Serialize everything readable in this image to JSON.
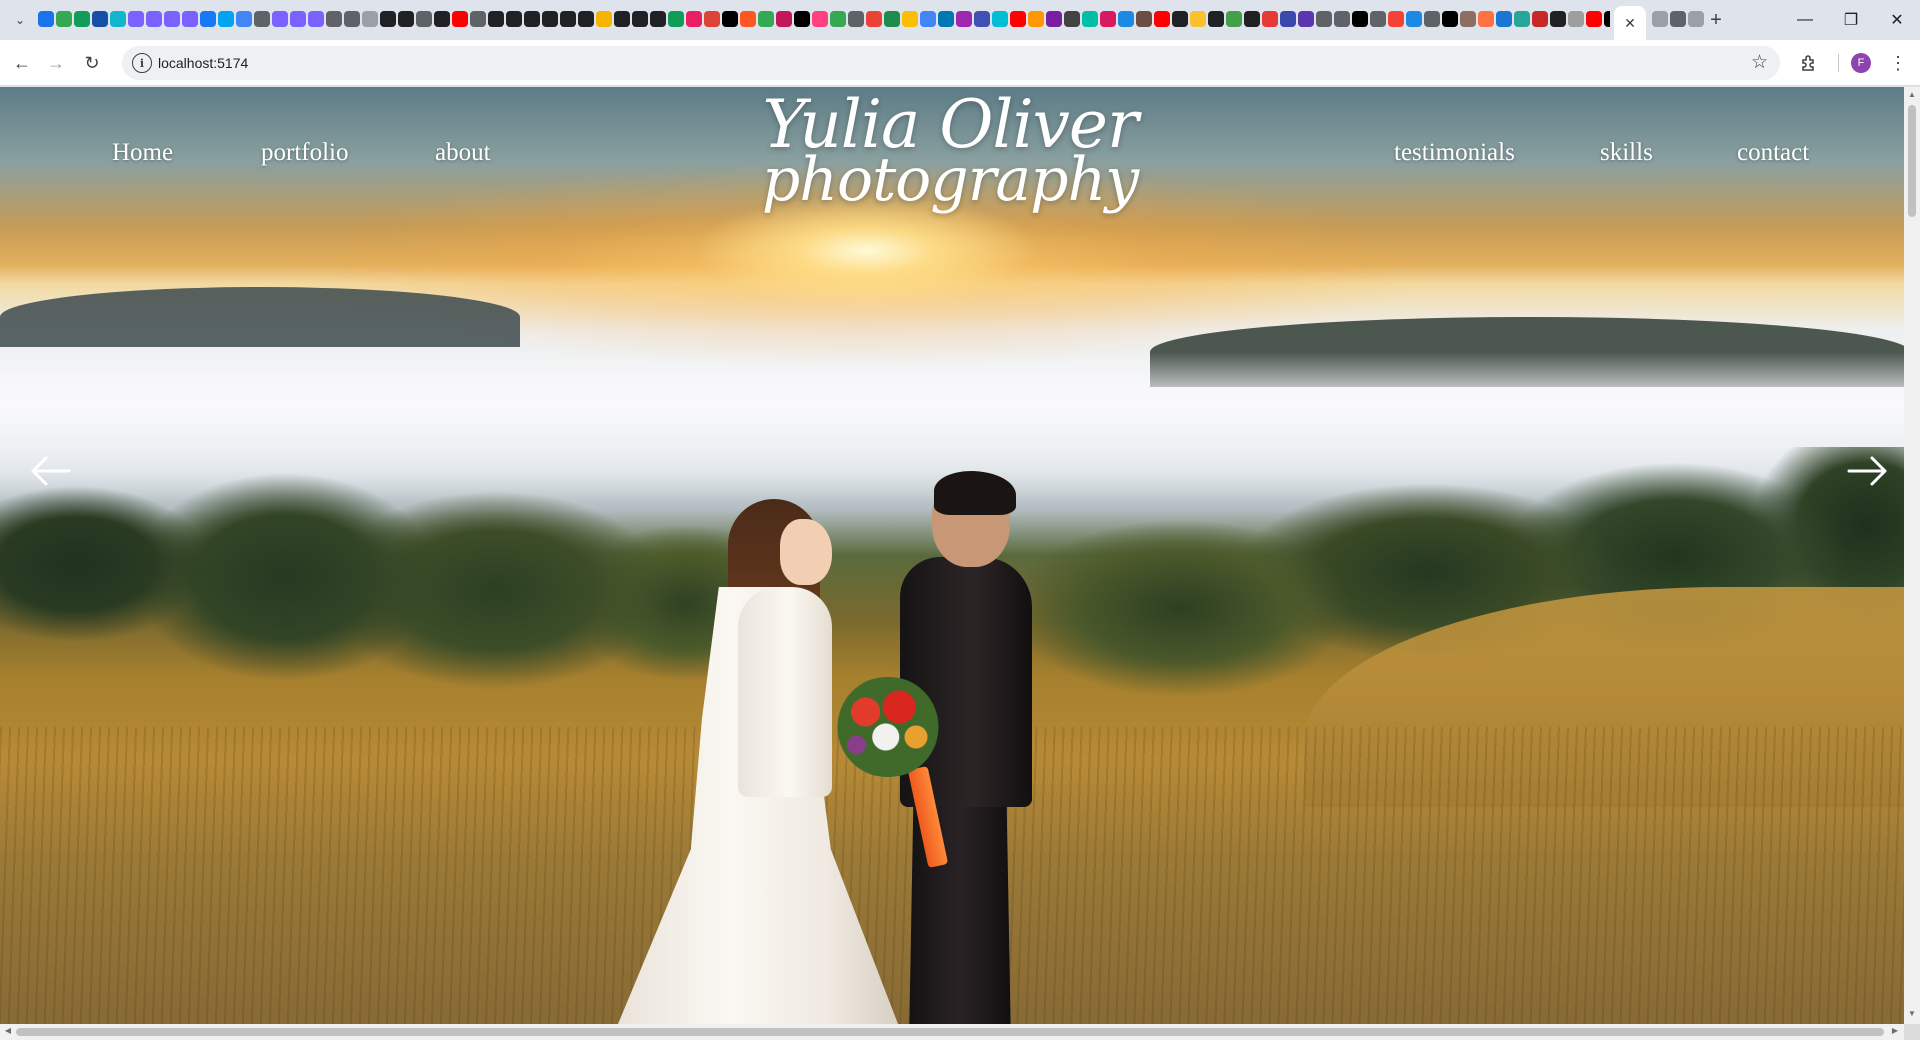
{
  "browser": {
    "tab_menu_icon": "chevron-down-icon",
    "active_tab_close": "✕",
    "new_tab": "+",
    "window_controls": {
      "minimize": "—",
      "restore": "❐",
      "close": "✕"
    },
    "favicon_colors": [
      "#1a73e8",
      "#34a853",
      "#0f9d58",
      "#174ea6",
      "#12b5cb",
      "#7b61ff",
      "#7b61ff",
      "#7b61ff",
      "#7b61ff",
      "#1877f2",
      "#00a4ef",
      "#4285f4",
      "#5f6368",
      "#7b61ff",
      "#7b61ff",
      "#7b61ff",
      "#5f6368",
      "#5f6368",
      "#9aa0a6",
      "#202124",
      "#202124",
      "#5f6368",
      "#202124",
      "#ff0000",
      "#5f6368",
      "#202124",
      "#202124",
      "#202124",
      "#202124",
      "#202124",
      "#202124",
      "#f4b400",
      "#202124",
      "#202124",
      "#202124",
      "#0f9d58",
      "#e91e63",
      "#db4437",
      "#000000",
      "#ff5722",
      "#34a853",
      "#c2185b",
      "#000000",
      "#ff4081",
      "#34a853",
      "#5f6368",
      "#ea4335",
      "#1f8b4c",
      "#fbbc04",
      "#4285f4",
      "#0077b5",
      "#9c27b0",
      "#3f51b5",
      "#00bcd4",
      "#ff0000",
      "#ff9800",
      "#7b1fa2",
      "#424242",
      "#00bfa5",
      "#d81b60",
      "#1e88e5",
      "#6d4c41",
      "#ff0000",
      "#202124",
      "#fbc02d",
      "#202124",
      "#43a047",
      "#202124",
      "#e53935",
      "#3949ab",
      "#5e35b1",
      "#5f6368",
      "#5f6368",
      "#000000",
      "#5f6368",
      "#f44336",
      "#1e88e5",
      "#5f6368",
      "#000000",
      "#8d6e63",
      "#ff7043",
      "#1976d2",
      "#26a69a",
      "#c62828",
      "#202124",
      "#9e9e9e",
      "#ff0000",
      "#000000",
      "#ab47bc",
      "#1a73e8",
      "#e53935",
      "#5f6368",
      "#7b61ff",
      "#9e9e9e",
      "#5f6368"
    ],
    "toolbar": {
      "back_icon": "←",
      "forward_icon": "→",
      "reload_icon": "↻",
      "site_info_icon": "i",
      "url": "localhost:5174",
      "bookmark_icon": "☆",
      "extensions_icon": "puzzle-icon",
      "profile_initial": "F",
      "menu_icon": "⋮"
    }
  },
  "site": {
    "logo": {
      "line1": "Yulia Oliver",
      "line2": "photography"
    },
    "nav_left": [
      "Home",
      "portfolio",
      "about"
    ],
    "nav_right": [
      "testimonials",
      "skills",
      "contact"
    ],
    "slider": {
      "prev_icon": "arrow-left-icon",
      "next_icon": "arrow-right-icon"
    },
    "accent": "#ffffff"
  }
}
